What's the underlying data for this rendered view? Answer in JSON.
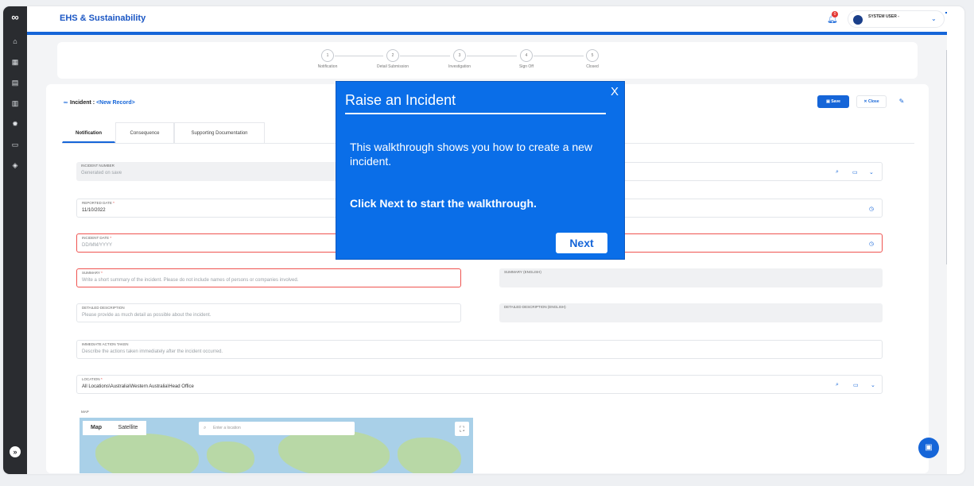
{
  "app": {
    "title": "EHS & Sustainability"
  },
  "header": {
    "notification_count": "0",
    "user_name": "SYSTEM USER -"
  },
  "stepper": {
    "steps": [
      {
        "num": "1",
        "label": "Notification"
      },
      {
        "num": "2",
        "label": "Detail Submission"
      },
      {
        "num": "3",
        "label": "Investigation"
      },
      {
        "num": "4",
        "label": "Sign Off"
      },
      {
        "num": "5",
        "label": "Closed"
      }
    ]
  },
  "record": {
    "title_prefix": "Incident : ",
    "title_link": "<New Record>",
    "save_label": "Save",
    "close_label": "Close"
  },
  "tabs": [
    "Notification",
    "Consequence",
    "Supporting Documentation"
  ],
  "form": {
    "incident_number": {
      "label": "INCIDENT NUMBER",
      "placeholder": "Generated on save"
    },
    "reported_date": {
      "label": "REPORTED DATE",
      "value": "11/10/2022"
    },
    "incident_date": {
      "label": "INCIDENT DATE",
      "placeholder": "DD/MM/YYYY"
    },
    "summary": {
      "label": "SUMMARY",
      "placeholder": "Write a short summary of the incident. Please do not include names of persons or companies involved."
    },
    "summary_en": {
      "label": "SUMMARY (ENGLISH)"
    },
    "detailed": {
      "label": "DETAILED DESCRIPTION",
      "placeholder": "Please provide as much detail as possible about the incident."
    },
    "detailed_en": {
      "label": "DETAILED DESCRIPTION (ENGLISH)"
    },
    "immediate": {
      "label": "IMMEDIATE ACTION TAKEN",
      "placeholder": "Describe the actions taken immediately after the incident occurred."
    },
    "location": {
      "label": "LOCATION",
      "value": "All Locations\\Australia\\Western Australia\\Head Office"
    },
    "map_label": "MAP"
  },
  "map": {
    "tab_map": "Map",
    "tab_satellite": "Satellite",
    "search_placeholder": "Enter a location"
  },
  "modal": {
    "title": "Raise an Incident",
    "close": "X",
    "body": "This walkthrough shows you how to create a new incident.",
    "cta": "Click Next to start the walkthrough.",
    "next_label": "Next"
  },
  "colors": {
    "accent": "#1565d8",
    "sidebar": "#2a2c30",
    "modal": "#0a6ee8",
    "error": "#ef5350"
  }
}
